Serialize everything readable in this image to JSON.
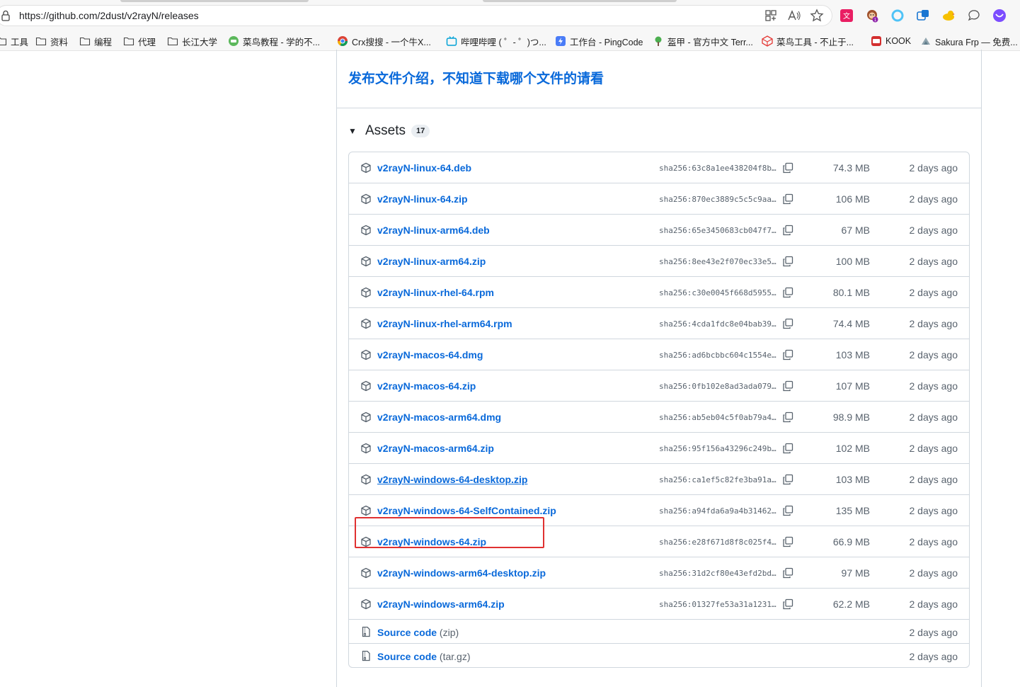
{
  "browser": {
    "url": "https://github.com/2dust/v2rayN/releases",
    "bookmarks": [
      {
        "label": "工具",
        "icon": "folder-icon"
      },
      {
        "label": "资料",
        "icon": "folder-icon"
      },
      {
        "label": "编程",
        "icon": "folder-icon"
      },
      {
        "label": "代理",
        "icon": "folder-icon"
      },
      {
        "label": "长江大学",
        "icon": "folder-icon"
      },
      {
        "label": "菜鸟教程 - 学的不...",
        "icon": "runoob-icon"
      },
      {
        "label": "Crx搜搜 - 一个牛X...",
        "icon": "chrome-icon"
      },
      {
        "label": "哔哩哔哩 ( ゜- ゜)つ...",
        "icon": "bilibili-icon"
      },
      {
        "label": "工作台 - PingCode",
        "icon": "pingcode-icon"
      },
      {
        "label": "盔甲 - 官方中文 Terr...",
        "icon": "terraria-icon"
      },
      {
        "label": "菜鸟工具 - 不止于...",
        "icon": "runoob-tools-icon"
      },
      {
        "label": "KOOK",
        "icon": "kook-icon"
      },
      {
        "label": "Sakura Frp — 免费...",
        "icon": "sakura-icon"
      }
    ],
    "extension_badge": "1"
  },
  "release": {
    "notice_link": "发布文件介绍，不知道下载哪个文件的请看",
    "assets_title": "Assets",
    "assets_count": "17",
    "assets": [
      {
        "name": "v2rayN-linux-64.deb",
        "sha": "sha256:63c8a1ee438204f8b…",
        "size": "74.3 MB",
        "date": "2 days ago"
      },
      {
        "name": "v2rayN-linux-64.zip",
        "sha": "sha256:870ec3889c5c5c9aa…",
        "size": "106 MB",
        "date": "2 days ago"
      },
      {
        "name": "v2rayN-linux-arm64.deb",
        "sha": "sha256:65e3450683cb047f7…",
        "size": "67 MB",
        "date": "2 days ago"
      },
      {
        "name": "v2rayN-linux-arm64.zip",
        "sha": "sha256:8ee43e2f070ec33e5…",
        "size": "100 MB",
        "date": "2 days ago"
      },
      {
        "name": "v2rayN-linux-rhel-64.rpm",
        "sha": "sha256:c30e0045f668d5955…",
        "size": "80.1 MB",
        "date": "2 days ago"
      },
      {
        "name": "v2rayN-linux-rhel-arm64.rpm",
        "sha": "sha256:4cda1fdc8e04bab39…",
        "size": "74.4 MB",
        "date": "2 days ago"
      },
      {
        "name": "v2rayN-macos-64.dmg",
        "sha": "sha256:ad6bcbbc604c1554e…",
        "size": "103 MB",
        "date": "2 days ago"
      },
      {
        "name": "v2rayN-macos-64.zip",
        "sha": "sha256:0fb102e8ad3ada079…",
        "size": "107 MB",
        "date": "2 days ago"
      },
      {
        "name": "v2rayN-macos-arm64.dmg",
        "sha": "sha256:ab5eb04c5f0ab79a4…",
        "size": "98.9 MB",
        "date": "2 days ago"
      },
      {
        "name": "v2rayN-macos-arm64.zip",
        "sha": "sha256:95f156a43296c249b…",
        "size": "102 MB",
        "date": "2 days ago"
      },
      {
        "name": "v2rayN-windows-64-desktop.zip",
        "sha": "sha256:ca1ef5c82fe3ba91a…",
        "size": "103 MB",
        "date": "2 days ago"
      },
      {
        "name": "v2rayN-windows-64-SelfContained.zip",
        "sha": "sha256:a94fda6a9a4b31462…",
        "size": "135 MB",
        "date": "2 days ago"
      },
      {
        "name": "v2rayN-windows-64.zip",
        "sha": "sha256:e28f671d8f8c025f4…",
        "size": "66.9 MB",
        "date": "2 days ago"
      },
      {
        "name": "v2rayN-windows-arm64-desktop.zip",
        "sha": "sha256:31d2cf80e43efd2bd…",
        "size": "97 MB",
        "date": "2 days ago"
      },
      {
        "name": "v2rayN-windows-arm64.zip",
        "sha": "sha256:01327fe53a31a1231…",
        "size": "62.2 MB",
        "date": "2 days ago"
      }
    ],
    "source": [
      {
        "label": "Source code",
        "format": "(zip)",
        "date": "2 days ago"
      },
      {
        "label": "Source code",
        "format": "(tar.gz)",
        "date": "2 days ago"
      }
    ],
    "highlighted_asset": "v2rayN-windows-64-desktop.zip",
    "colors": {
      "link": "#0969da",
      "muted": "#59636e",
      "border": "#d0d7de",
      "highlight": "#e03131"
    }
  }
}
